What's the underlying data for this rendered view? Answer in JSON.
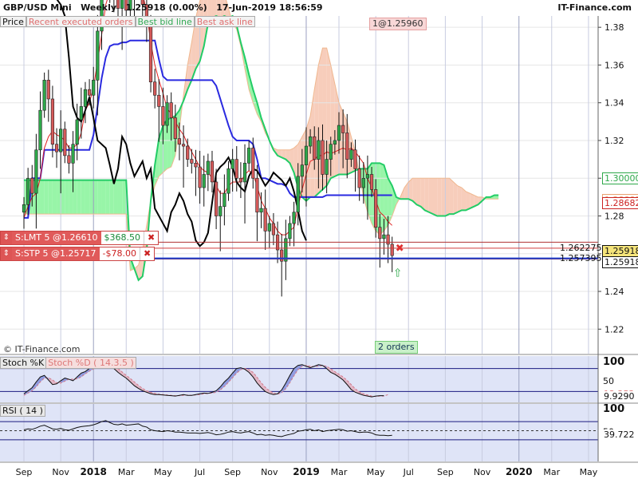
{
  "header": {
    "instrument": "GBP/USD Mini",
    "timeframe": "Weekly",
    "price": "1.25918 (0.00%)",
    "datetime": "17-Jun-2019 18:56:59",
    "brand": "IT-Finance.com"
  },
  "toggles": [
    "Price",
    "Recent executed orders",
    "Best bid line",
    "Best ask line"
  ],
  "last_trade": "1@1.25960",
  "orders": [
    {
      "label": "S:LMT  5 @1.26610",
      "pnl": "$368.50",
      "pnl_sign": "pos"
    },
    {
      "label": "S:STP  5 @1.25717",
      "pnl": "-$78.00",
      "pnl_sign": "neg"
    }
  ],
  "orders_count": "2 orders",
  "copyright": "© IT-Finance.com",
  "colors": {
    "bull_candle": "#2ea84a",
    "bear_candle": "#d65a5a",
    "kumo_bull": "#98f5a8",
    "kumo_bear": "#f7cdbb",
    "kijun": "#2a2ae0",
    "tenkan": "#e02020",
    "chikou": "#000000",
    "senkou_a": "#22cc66",
    "senkou_b": "#f0b890"
  },
  "panels": {
    "stoch_label_k": "Stoch %K",
    "stoch_label_d": "Stoch %D ( 14.3.5 )",
    "rsi_label": "RSI ( 14 )"
  },
  "price_tags": [
    {
      "text": "1.30000",
      "y_value": 1.3,
      "color": "#2ea84a",
      "bg": "#ffffff"
    },
    {
      "text": "1.28885",
      "y_value": 1.2888,
      "color": "#e9a070",
      "bg": "#ffffff"
    },
    {
      "text": "1.28682",
      "y_value": 1.2868,
      "color": "#c22",
      "bg": "#ffffff"
    },
    {
      "text": "1.262275",
      "y_value": 1.2629,
      "color": "#111",
      "bg": "#ffffff",
      "inside": true
    },
    {
      "text": "1.257395",
      "y_value": 1.2575,
      "color": "#111",
      "bg": "#ffffff",
      "inside": true
    },
    {
      "text": "1.25918",
      "y_value": 1.2618,
      "color": "#111",
      "bg": "#f5e47a"
    },
    {
      "text": "1.25918",
      "y_value": 1.2556,
      "color": "#111",
      "bg": "#ffffff"
    }
  ],
  "stoch_tags": [
    {
      "text": "12.252",
      "y_value": 12,
      "color": "#d77"
    },
    {
      "text": "9.9290",
      "y_value": 6,
      "color": "#111"
    }
  ],
  "rsi_tags": [
    {
      "text": "39.722",
      "y_value": 40,
      "color": "#111"
    }
  ],
  "chart_data": {
    "type": "line",
    "title": "GBP/USD Mini Weekly",
    "x_ticks": [
      "Sep",
      "Nov",
      "2018",
      "Mar",
      "May",
      "Jul",
      "Sep",
      "Nov",
      "2019",
      "Mar",
      "May",
      "Jul",
      "Sep",
      "Nov",
      "2020",
      "Mar",
      "May"
    ],
    "x_tick_weeks": [
      0,
      9,
      17,
      25,
      34,
      43,
      51,
      60,
      69,
      77,
      86,
      94,
      103,
      112,
      121,
      129,
      138
    ],
    "major_x_ticks": [
      "2018",
      "2019",
      "2020"
    ],
    "price_axis": {
      "ticks": [
        1.38,
        1.36,
        1.34,
        1.32,
        1.3,
        1.28,
        1.26,
        1.24,
        1.22
      ],
      "major": [
        1.3
      ],
      "range": [
        1.207,
        1.386
      ]
    },
    "stoch_axis": {
      "ticks": [
        100,
        50
      ],
      "range": [
        0,
        100
      ]
    },
    "rsi_axis": {
      "ticks": [
        100,
        50
      ],
      "range": [
        0,
        100
      ]
    },
    "levels": {
      "limit_order": 1.2661,
      "stop_order": 1.25717,
      "bid": 1.2575,
      "ask": 1.2629
    },
    "candles_note": "weekly OHLC, week index 0 = start of Sep 2017 (approx.)",
    "close": [
      1.286,
      1.3,
      1.292,
      1.315,
      1.336,
      1.352,
      1.342,
      1.318,
      1.314,
      1.326,
      1.312,
      1.308,
      1.318,
      1.331,
      1.338,
      1.347,
      1.344,
      1.352,
      1.378,
      1.402,
      1.42,
      1.405,
      1.395,
      1.39,
      1.405,
      1.389,
      1.397,
      1.408,
      1.42,
      1.392,
      1.381,
      1.351,
      1.344,
      1.338,
      1.328,
      1.34,
      1.332,
      1.321,
      1.318,
      1.317,
      1.31,
      1.308,
      1.306,
      1.295,
      1.302,
      1.309,
      1.298,
      1.28,
      1.285,
      1.292,
      1.305,
      1.31,
      1.3,
      1.298,
      1.308,
      1.316,
      1.3,
      1.282,
      1.284,
      1.272,
      1.276,
      1.27,
      1.262,
      1.256,
      1.268,
      1.276,
      1.282,
      1.301,
      1.307,
      1.317,
      1.322,
      1.31,
      1.32,
      1.302,
      1.31,
      1.318,
      1.32,
      1.328,
      1.324,
      1.31,
      1.315,
      1.305,
      1.295,
      1.3,
      1.302,
      1.294,
      1.274,
      1.268,
      1.27,
      1.265,
      1.259
    ],
    "kijun": [
      1.279,
      1.279,
      1.3,
      1.3,
      1.3,
      1.315,
      1.315,
      1.315,
      1.315,
      1.315,
      1.315,
      1.315,
      1.315,
      1.315,
      1.315,
      1.315,
      1.315,
      1.323,
      1.338,
      1.353,
      1.364,
      1.37,
      1.371,
      1.371,
      1.372,
      1.372,
      1.373,
      1.373,
      1.373,
      1.373,
      1.373,
      1.373,
      1.373,
      1.363,
      1.354,
      1.352,
      1.352,
      1.352,
      1.352,
      1.352,
      1.352,
      1.352,
      1.352,
      1.352,
      1.352,
      1.352,
      1.352,
      1.349,
      1.342,
      1.335,
      1.328,
      1.322,
      1.32,
      1.32,
      1.32,
      1.32,
      1.318,
      1.31,
      1.3,
      1.3,
      1.299,
      1.298,
      1.297,
      1.297,
      1.296,
      1.292,
      1.29,
      1.29,
      1.29,
      1.29,
      1.29,
      1.29,
      1.29,
      1.29,
      1.291,
      1.291,
      1.291,
      1.291,
      1.291,
      1.291,
      1.291,
      1.291,
      1.291,
      1.291,
      1.291,
      1.291,
      1.291,
      1.291,
      1.291,
      1.291,
      1.291
    ],
    "tenkan": [
      1.279,
      1.285,
      1.29,
      1.292,
      1.3,
      1.316,
      1.322,
      1.325,
      1.323,
      1.322,
      1.32,
      1.316,
      1.316,
      1.318,
      1.324,
      1.336,
      1.34,
      1.348,
      1.362,
      1.376,
      1.392,
      1.399,
      1.4,
      1.4,
      1.4,
      1.397,
      1.397,
      1.398,
      1.404,
      1.398,
      1.388,
      1.372,
      1.36,
      1.352,
      1.345,
      1.337,
      1.334,
      1.33,
      1.326,
      1.323,
      1.318,
      1.314,
      1.31,
      1.306,
      1.304,
      1.303,
      1.3,
      1.296,
      1.292,
      1.292,
      1.296,
      1.298,
      1.298,
      1.298,
      1.302,
      1.304,
      1.302,
      1.296,
      1.288,
      1.284,
      1.279,
      1.276,
      1.272,
      1.27,
      1.27,
      1.272,
      1.274,
      1.285,
      1.294,
      1.302,
      1.309,
      1.31,
      1.312,
      1.312,
      1.314,
      1.313,
      1.314,
      1.315,
      1.316,
      1.315,
      1.316,
      1.314,
      1.311,
      1.308,
      1.3,
      1.295,
      1.288,
      1.282,
      1.28,
      1.277,
      1.275
    ],
    "chikou": [
      1.395,
      1.392,
      1.386,
      1.364,
      1.338,
      1.332,
      1.33,
      1.336,
      1.343,
      1.332,
      1.32,
      1.318,
      1.316,
      1.307,
      1.297,
      1.305,
      1.322,
      1.318,
      1.308,
      1.301,
      1.305,
      1.309,
      1.3,
      1.305,
      1.284,
      1.28,
      1.276,
      1.272,
      1.282,
      1.286,
      1.292,
      1.288,
      1.281,
      1.277,
      1.267,
      1.264,
      1.266,
      1.271,
      1.287,
      1.303,
      1.306,
      1.308,
      1.311,
      1.306,
      1.298,
      1.295,
      1.293,
      1.301,
      1.305,
      1.304,
      1.3,
      1.296,
      1.299,
      1.303,
      1.301,
      1.299,
      1.296,
      1.3,
      1.293,
      1.283,
      1.272,
      1.267
    ],
    "senkou_a": [
      1.299,
      1.299,
      1.299,
      1.299,
      1.299,
      1.299,
      1.299,
      1.299,
      1.299,
      1.299,
      1.299,
      1.299,
      1.299,
      1.299,
      1.299,
      1.299,
      1.299,
      1.299,
      1.299,
      1.299,
      1.299,
      1.299,
      1.299,
      1.299,
      1.299,
      1.299,
      1.258,
      1.252,
      1.246,
      1.248,
      1.262,
      1.288,
      1.307,
      1.321,
      1.328,
      1.331,
      1.332,
      1.333,
      1.336,
      1.341,
      1.347,
      1.352,
      1.358,
      1.362,
      1.37,
      1.382,
      1.385,
      1.386,
      1.385,
      1.386,
      1.385,
      1.386,
      1.381,
      1.372,
      1.364,
      1.355,
      1.347,
      1.34,
      1.332,
      1.326,
      1.32,
      1.315,
      1.312,
      1.311,
      1.31,
      1.308,
      1.303,
      1.295,
      1.29,
      1.288,
      1.29,
      1.29,
      1.292,
      1.294,
      1.296,
      1.3,
      1.301,
      1.302,
      1.302,
      1.302,
      1.303,
      1.304,
      1.305,
      1.305,
      1.305,
      1.308,
      1.308,
      1.308,
      1.307,
      1.3,
      1.296,
      1.29,
      1.289,
      1.289,
      1.289,
      1.288,
      1.286,
      1.285,
      1.283,
      1.282,
      1.281,
      1.28,
      1.28,
      1.28,
      1.281,
      1.281,
      1.282,
      1.283,
      1.283,
      1.284,
      1.285,
      1.286,
      1.288,
      1.29,
      1.29,
      1.291,
      1.291
    ],
    "senkou_b": [
      1.281,
      1.281,
      1.281,
      1.281,
      1.281,
      1.281,
      1.281,
      1.281,
      1.281,
      1.281,
      1.281,
      1.281,
      1.281,
      1.281,
      1.281,
      1.281,
      1.281,
      1.281,
      1.281,
      1.281,
      1.281,
      1.281,
      1.281,
      1.281,
      1.281,
      1.281,
      1.251,
      1.252,
      1.254,
      1.262,
      1.275,
      1.288,
      1.296,
      1.301,
      1.303,
      1.305,
      1.306,
      1.312,
      1.326,
      1.344,
      1.36,
      1.372,
      1.385,
      1.394,
      1.4,
      1.401,
      1.404,
      1.405,
      1.403,
      1.398,
      1.39,
      1.382,
      1.379,
      1.37,
      1.358,
      1.347,
      1.34,
      1.334,
      1.33,
      1.324,
      1.32,
      1.316,
      1.315,
      1.315,
      1.315,
      1.315,
      1.316,
      1.318,
      1.322,
      1.326,
      1.333,
      1.347,
      1.36,
      1.369,
      1.369,
      1.36,
      1.35,
      1.34,
      1.335,
      1.33,
      1.322,
      1.314,
      1.302,
      1.29,
      1.282,
      1.276,
      1.272,
      1.27,
      1.272,
      1.275,
      1.28,
      1.286,
      1.29,
      1.295,
      1.298,
      1.3,
      1.3,
      1.3,
      1.3,
      1.3,
      1.3,
      1.3,
      1.3,
      1.3,
      1.3,
      1.298,
      1.296,
      1.295,
      1.293,
      1.292,
      1.291,
      1.29,
      1.29,
      1.289,
      1.289,
      1.289,
      1.289
    ],
    "stoch_k": [
      14,
      22,
      30,
      45,
      58,
      62,
      50,
      38,
      40,
      48,
      55,
      52,
      48,
      58,
      68,
      72,
      80,
      85,
      88,
      90,
      92,
      88,
      80,
      70,
      62,
      55,
      45,
      35,
      28,
      22,
      18,
      14,
      12,
      12,
      11,
      10,
      9,
      8,
      10,
      12,
      10,
      10,
      12,
      14,
      16,
      15,
      18,
      22,
      32,
      45,
      55,
      68,
      80,
      82,
      78,
      70,
      58,
      42,
      30,
      20,
      15,
      12,
      14,
      24,
      42,
      62,
      80,
      88,
      90,
      86,
      82,
      86,
      90,
      88,
      80,
      70,
      65,
      58,
      50,
      38,
      25,
      18,
      14,
      10,
      8,
      6,
      8,
      9,
      9
    ],
    "stoch_d": [
      10,
      16,
      22,
      32,
      45,
      55,
      56,
      50,
      43,
      42,
      47,
      52,
      52,
      53,
      58,
      66,
      73,
      79,
      84,
      88,
      90,
      90,
      87,
      80,
      71,
      62,
      54,
      45,
      36,
      28,
      22,
      18,
      15,
      13,
      12,
      11,
      10,
      9,
      9,
      10,
      11,
      10,
      11,
      12,
      14,
      15,
      16,
      18,
      24,
      33,
      44,
      56,
      68,
      77,
      80,
      77,
      70,
      57,
      43,
      31,
      22,
      16,
      13,
      17,
      27,
      43,
      61,
      77,
      86,
      88,
      86,
      85,
      86,
      88,
      86,
      79,
      72,
      65,
      58,
      49,
      38,
      27,
      19,
      14,
      11,
      8,
      7,
      8,
      8,
      12
    ],
    "rsi": [
      52,
      54,
      53,
      56,
      60,
      62,
      58,
      54,
      53,
      55,
      52,
      51,
      54,
      57,
      59,
      60,
      61,
      63,
      66,
      70,
      72,
      68,
      64,
      63,
      65,
      62,
      63,
      64,
      65,
      60,
      58,
      52,
      50,
      49,
      48,
      50,
      49,
      47,
      47,
      46,
      45,
      45,
      45,
      44,
      45,
      46,
      44,
      41,
      42,
      44,
      47,
      48,
      46,
      45,
      47,
      48,
      45,
      41,
      42,
      40,
      41,
      40,
      38,
      37,
      40,
      42,
      44,
      49,
      50,
      52,
      53,
      50,
      52,
      48,
      50,
      51,
      52,
      53,
      52,
      49,
      50,
      48,
      46,
      47,
      47,
      45,
      41,
      40,
      40,
      39,
      40
    ]
  }
}
